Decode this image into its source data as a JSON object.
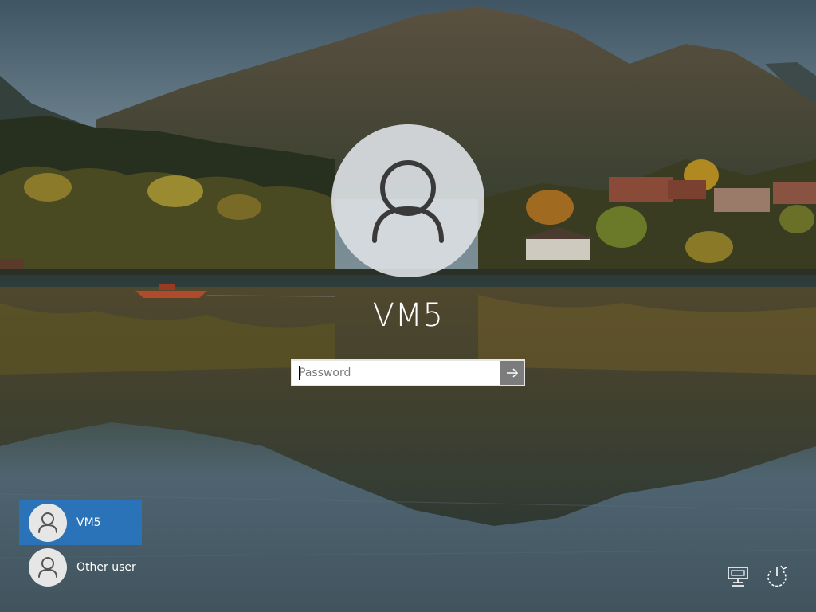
{
  "login": {
    "username": "VM5",
    "password_value": "",
    "password_placeholder": "Password",
    "submit_icon": "arrow-right-icon"
  },
  "user_list": [
    {
      "name": "VM5",
      "selected": true,
      "icon": "user-avatar-icon"
    },
    {
      "name": "Other user",
      "selected": false,
      "icon": "user-avatar-icon"
    }
  ],
  "system_icons": [
    "network-icon",
    "power-icon"
  ],
  "colors": {
    "selected_tile": "#2a73b8",
    "text": "#ffffff",
    "avatar_bg": "#dadee2"
  }
}
